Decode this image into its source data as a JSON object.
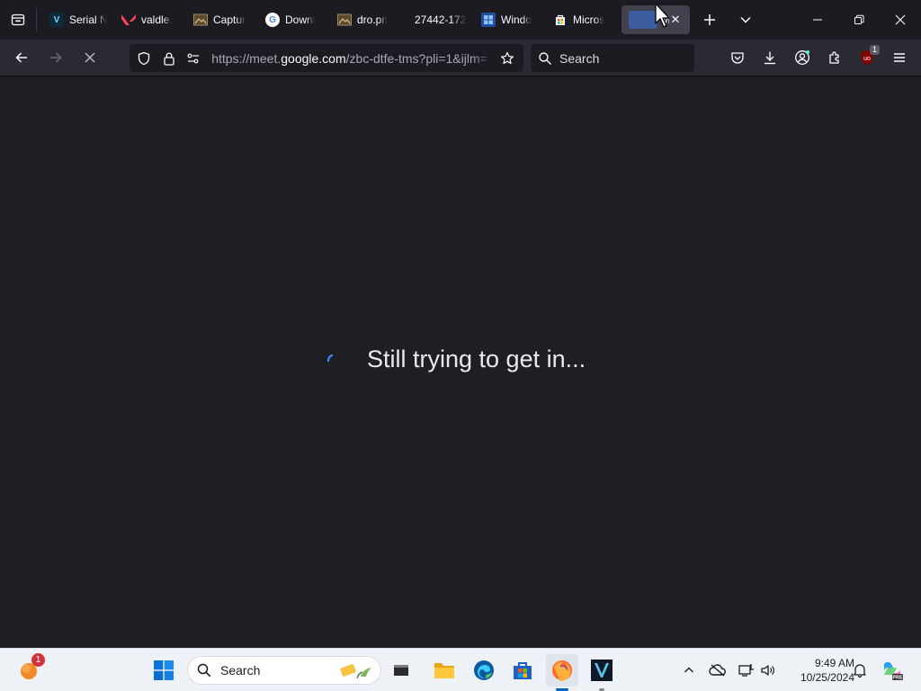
{
  "tabs": [
    {
      "title": "Serial N",
      "fav_letter": "V",
      "fav_color": "#0b2b3b"
    },
    {
      "title": "valdle.",
      "fav_letter": "",
      "fav_color": "#ff4655"
    },
    {
      "title": "Captur",
      "fav_letter": "",
      "fav_color": "#6b5a3a"
    },
    {
      "title": "Downl",
      "fav_letter": "G",
      "fav_color": "#ffffff"
    },
    {
      "title": "dro.pn",
      "fav_letter": "",
      "fav_color": "#6b5a3a"
    },
    {
      "title": "27442-1726",
      "fav_letter": "",
      "fav_color": ""
    },
    {
      "title": "Windo",
      "fav_letter": "",
      "fav_color": "#2f6fd0"
    },
    {
      "title": "Micros",
      "fav_letter": "",
      "fav_color": "#ffffff"
    }
  ],
  "active_tab": {
    "title": "M",
    "close": "✕"
  },
  "url": {
    "prefix": "https://meet.",
    "domain": "google.com",
    "path": "/zbc-dtfe-tms?pli=1&ijlm="
  },
  "search": {
    "placeholder": "Search"
  },
  "extension_badge": "1",
  "content": {
    "status": "Still trying to get in..."
  },
  "taskbar": {
    "search_placeholder": "Search",
    "weather_badge": "1",
    "clock_time": "9:49 AM",
    "clock_date": "10/25/2024"
  },
  "colors": {
    "accent": "#0067c0",
    "page_bg": "#1f1e25",
    "tab_strip": "#1c1b22",
    "toolbar": "#2b2a33"
  }
}
